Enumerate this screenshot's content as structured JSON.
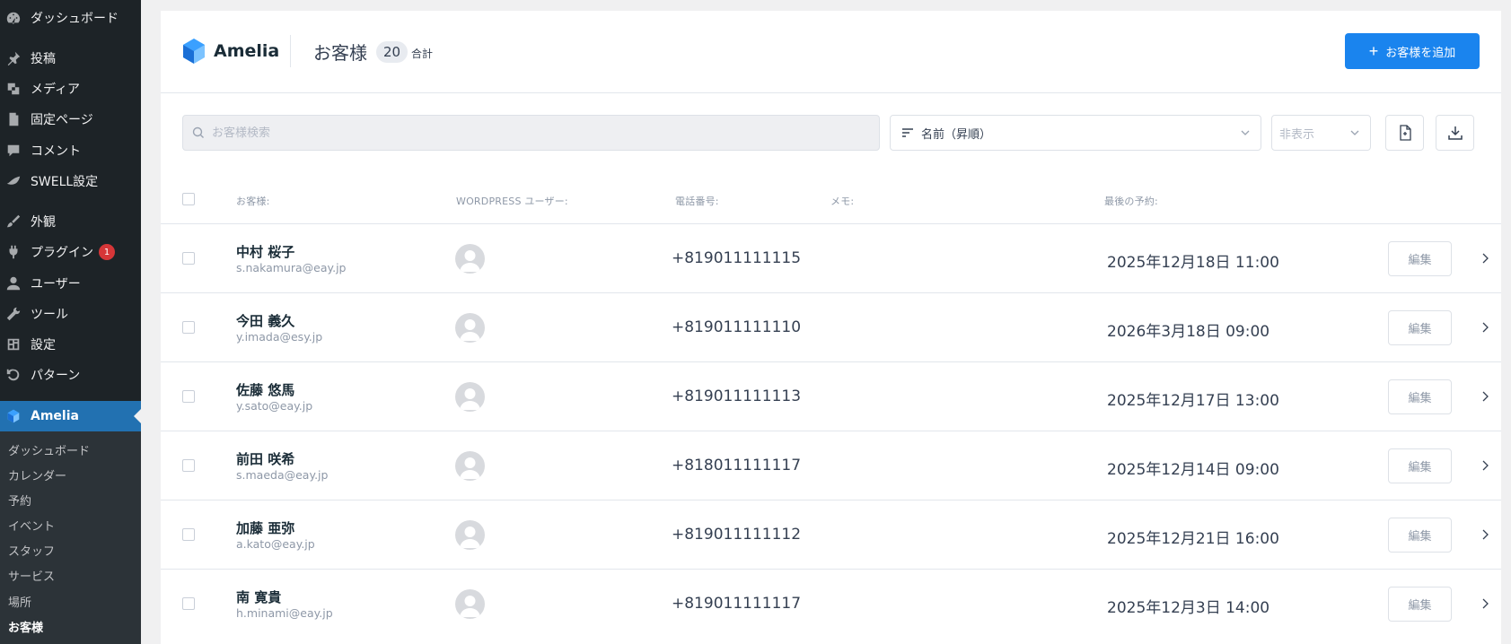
{
  "sidebar": {
    "items": [
      {
        "label": "ダッシュボード",
        "icon": "dashboard-icon"
      },
      {
        "label": "投稿",
        "icon": "pin-icon"
      },
      {
        "label": "メディア",
        "icon": "media-icon"
      },
      {
        "label": "固定ページ",
        "icon": "page-icon"
      },
      {
        "label": "コメント",
        "icon": "comment-icon"
      },
      {
        "label": "SWELL設定",
        "icon": "swell-icon"
      },
      {
        "label": "外観",
        "icon": "brush-icon"
      },
      {
        "label": "プラグイン",
        "icon": "plugin-icon",
        "badge": "1"
      },
      {
        "label": "ユーザー",
        "icon": "user-icon"
      },
      {
        "label": "ツール",
        "icon": "wrench-icon"
      },
      {
        "label": "設定",
        "icon": "settings-icon"
      },
      {
        "label": "パターン",
        "icon": "pattern-icon"
      },
      {
        "label": "Amelia",
        "icon": "amelia-icon"
      }
    ],
    "submenu": [
      "ダッシュボード",
      "カレンダー",
      "予約",
      "イベント",
      "スタッフ",
      "サービス",
      "場所",
      "お客様"
    ]
  },
  "header": {
    "brand": "Amelia",
    "title": "お客様",
    "count": "20",
    "count_label": "合計",
    "add_button": "お客様を追加"
  },
  "toolbar": {
    "search_placeholder": "お客様検索",
    "sort_value": "名前（昇順）",
    "hide_placeholder": "非表示"
  },
  "table": {
    "columns": {
      "customer": "お客様:",
      "wp_user": "WORDPRESS ユーザー:",
      "phone": "電話番号:",
      "memo": "メモ:",
      "last": "最後の予約:"
    },
    "edit_label": "編集",
    "rows": [
      {
        "name": "中村 桜子",
        "email": "s.nakamura@eay.jp",
        "phone": "+819011111115",
        "last": "2025年12月18日 11:00"
      },
      {
        "name": "今田 義久",
        "email": "y.imada@esy.jp",
        "phone": "+819011111110",
        "last": "2026年3月18日 09:00"
      },
      {
        "name": "佐藤 悠馬",
        "email": "y.sato@eay.jp",
        "phone": "+819011111113",
        "last": "2025年12月17日 13:00"
      },
      {
        "name": "前田 咲希",
        "email": "s.maeda@eay.jp",
        "phone": "+818011111117",
        "last": "2025年12月14日 09:00"
      },
      {
        "name": "加藤 亜弥",
        "email": "a.kato@eay.jp",
        "phone": "+819011111112",
        "last": "2025年12月21日 16:00"
      },
      {
        "name": "南 寛貴",
        "email": "h.minami@eay.jp",
        "phone": "+819011111117",
        "last": "2025年12月3日 14:00"
      }
    ]
  },
  "colors": {
    "sidebar_bg": "#1d2327",
    "active_bg": "#2271b1",
    "primary": "#1a84ee",
    "badge": "#d63638"
  }
}
